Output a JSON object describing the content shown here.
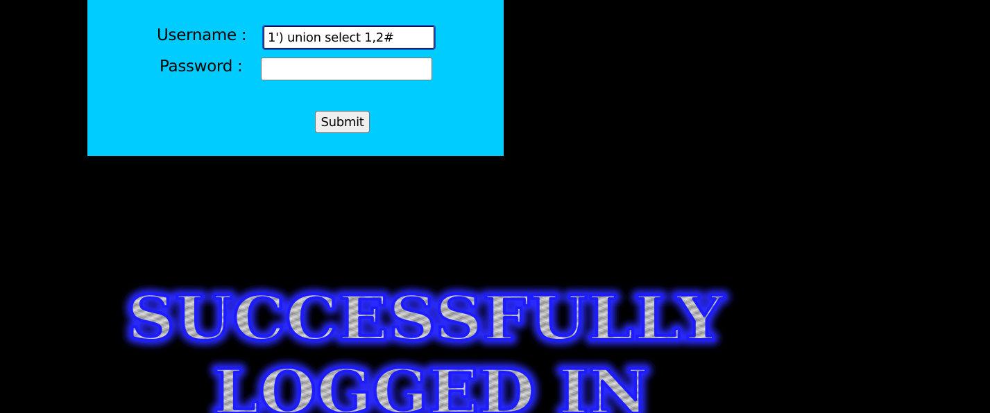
{
  "login_form": {
    "username_label": "Username :",
    "password_label": "Password :",
    "username_value": "1') union select 1,2#",
    "password_value": "",
    "submit_label": "Submit"
  },
  "result_banner": {
    "line1": "SUCCESSFULLY",
    "line2": "LOGGED IN"
  },
  "colors": {
    "page_background": "#000000",
    "form_background": "#00ccff",
    "banner_glow": "#1a1aff"
  }
}
